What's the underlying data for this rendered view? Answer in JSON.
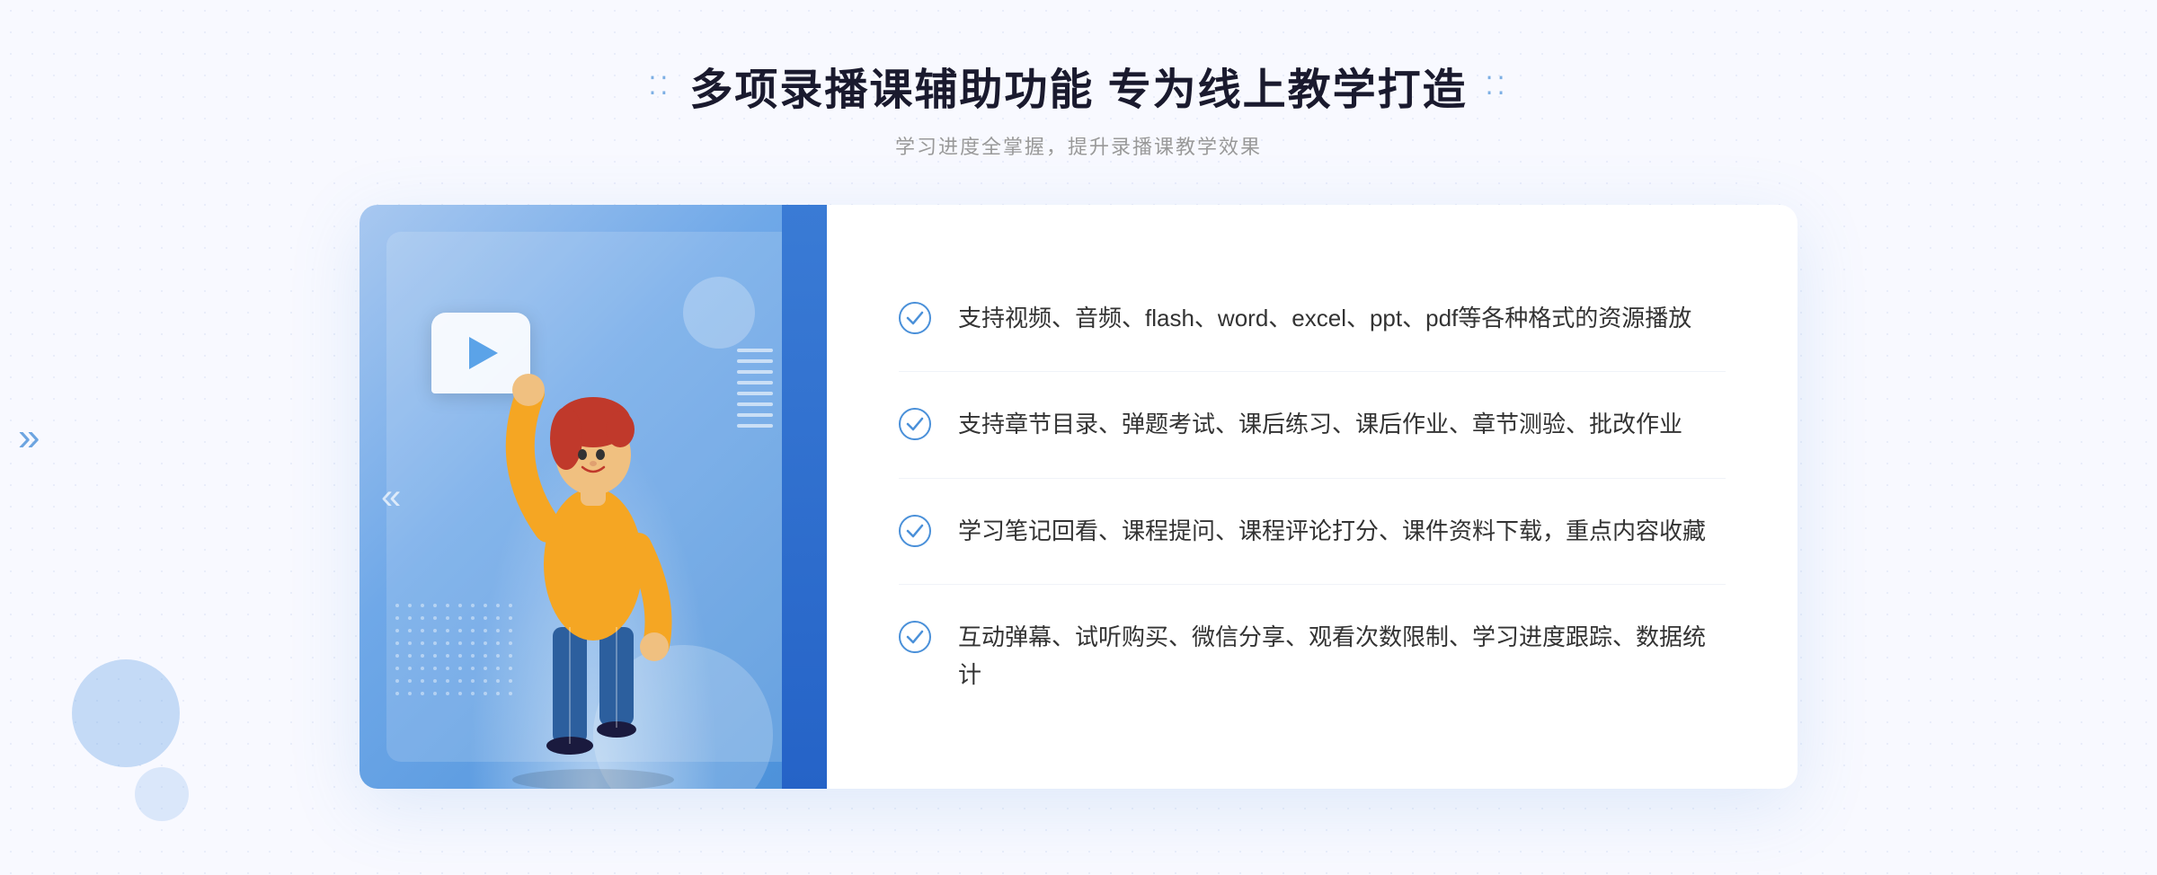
{
  "header": {
    "dots_left": "⁚⁚",
    "dots_right": "⁚⁚",
    "title": "多项录播课辅助功能 专为线上教学打造",
    "subtitle": "学习进度全掌握，提升录播课教学效果"
  },
  "features": [
    {
      "id": 1,
      "text": "支持视频、音频、flash、word、excel、ppt、pdf等各种格式的资源播放"
    },
    {
      "id": 2,
      "text": "支持章节目录、弹题考试、课后练习、课后作业、章节测验、批改作业"
    },
    {
      "id": 3,
      "text": "学习笔记回看、课程提问、课程评论打分、课件资料下载，重点内容收藏"
    },
    {
      "id": 4,
      "text": "互动弹幕、试听购买、微信分享、观看次数限制、学习进度跟踪、数据统计"
    }
  ],
  "check_icon_color": "#4a90d9",
  "accent_color": "#4a90d9",
  "background_color": "#f0f4fc"
}
